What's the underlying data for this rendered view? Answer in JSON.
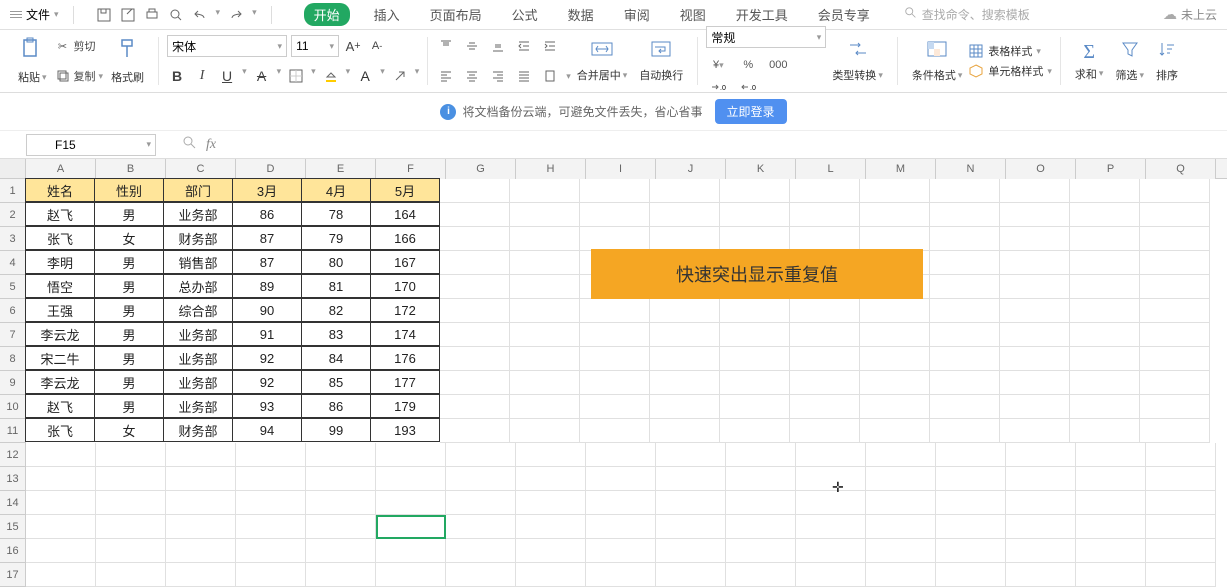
{
  "menubar": {
    "file": "文件"
  },
  "tabs": [
    "开始",
    "插入",
    "页面布局",
    "公式",
    "数据",
    "审阅",
    "视图",
    "开发工具",
    "会员专享"
  ],
  "search": {
    "placeholder": "查找命令、搜索模板"
  },
  "cloud_status": "未上云",
  "ribbon": {
    "paste": "粘贴",
    "cut": "剪切",
    "copy": "复制",
    "format_painter": "格式刷",
    "font_name": "宋体",
    "font_size": "11",
    "merge_center": "合并居中",
    "auto_wrap": "自动换行",
    "number_format": "常规",
    "type_convert": "类型转换",
    "cond_format": "条件格式",
    "table_style": "表格样式",
    "cell_style": "单元格样式",
    "sum": "求和",
    "filter": "筛选",
    "sort": "排序"
  },
  "banner": {
    "text": "将文档备份云端，可避免文件丢失，省心省事",
    "login": "立即登录"
  },
  "name_box": "F15",
  "columns": [
    "A",
    "B",
    "C",
    "D",
    "E",
    "F",
    "G",
    "H",
    "I",
    "J",
    "K",
    "L",
    "M",
    "N",
    "O",
    "P",
    "Q"
  ],
  "row_numbers": [
    "1",
    "2",
    "3",
    "4",
    "5",
    "6",
    "7",
    "8",
    "9",
    "10",
    "11",
    "12",
    "13",
    "14",
    "15",
    "16",
    "17"
  ],
  "table": {
    "headers": [
      "姓名",
      "性别",
      "部门",
      "3月",
      "4月",
      "5月"
    ],
    "rows": [
      [
        "赵飞",
        "男",
        "业务部",
        "86",
        "78",
        "164"
      ],
      [
        "张飞",
        "女",
        "财务部",
        "87",
        "79",
        "166"
      ],
      [
        "李明",
        "男",
        "销售部",
        "87",
        "80",
        "167"
      ],
      [
        "悟空",
        "男",
        "总办部",
        "89",
        "81",
        "170"
      ],
      [
        "王强",
        "男",
        "综合部",
        "90",
        "82",
        "172"
      ],
      [
        "李云龙",
        "男",
        "业务部",
        "91",
        "83",
        "174"
      ],
      [
        "宋二牛",
        "男",
        "业务部",
        "92",
        "84",
        "176"
      ],
      [
        "李云龙",
        "男",
        "业务部",
        "92",
        "85",
        "177"
      ],
      [
        "赵飞",
        "男",
        "业务部",
        "93",
        "86",
        "179"
      ],
      [
        "张飞",
        "女",
        "财务部",
        "94",
        "99",
        "193"
      ]
    ]
  },
  "callout": "快速突出显示重复值",
  "chart_data": {
    "type": "table",
    "title": "快速突出显示重复值",
    "columns": [
      "姓名",
      "性别",
      "部门",
      "3月",
      "4月",
      "5月"
    ],
    "rows": [
      [
        "赵飞",
        "男",
        "业务部",
        86,
        78,
        164
      ],
      [
        "张飞",
        "女",
        "财务部",
        87,
        79,
        166
      ],
      [
        "李明",
        "男",
        "销售部",
        87,
        80,
        167
      ],
      [
        "悟空",
        "男",
        "总办部",
        89,
        81,
        170
      ],
      [
        "王强",
        "男",
        "综合部",
        90,
        82,
        172
      ],
      [
        "李云龙",
        "男",
        "业务部",
        91,
        83,
        174
      ],
      [
        "宋二牛",
        "男",
        "业务部",
        92,
        84,
        176
      ],
      [
        "李云龙",
        "男",
        "业务部",
        92,
        85,
        177
      ],
      [
        "赵飞",
        "男",
        "业务部",
        93,
        86,
        179
      ],
      [
        "张飞",
        "女",
        "财务部",
        94,
        99,
        193
      ]
    ]
  }
}
